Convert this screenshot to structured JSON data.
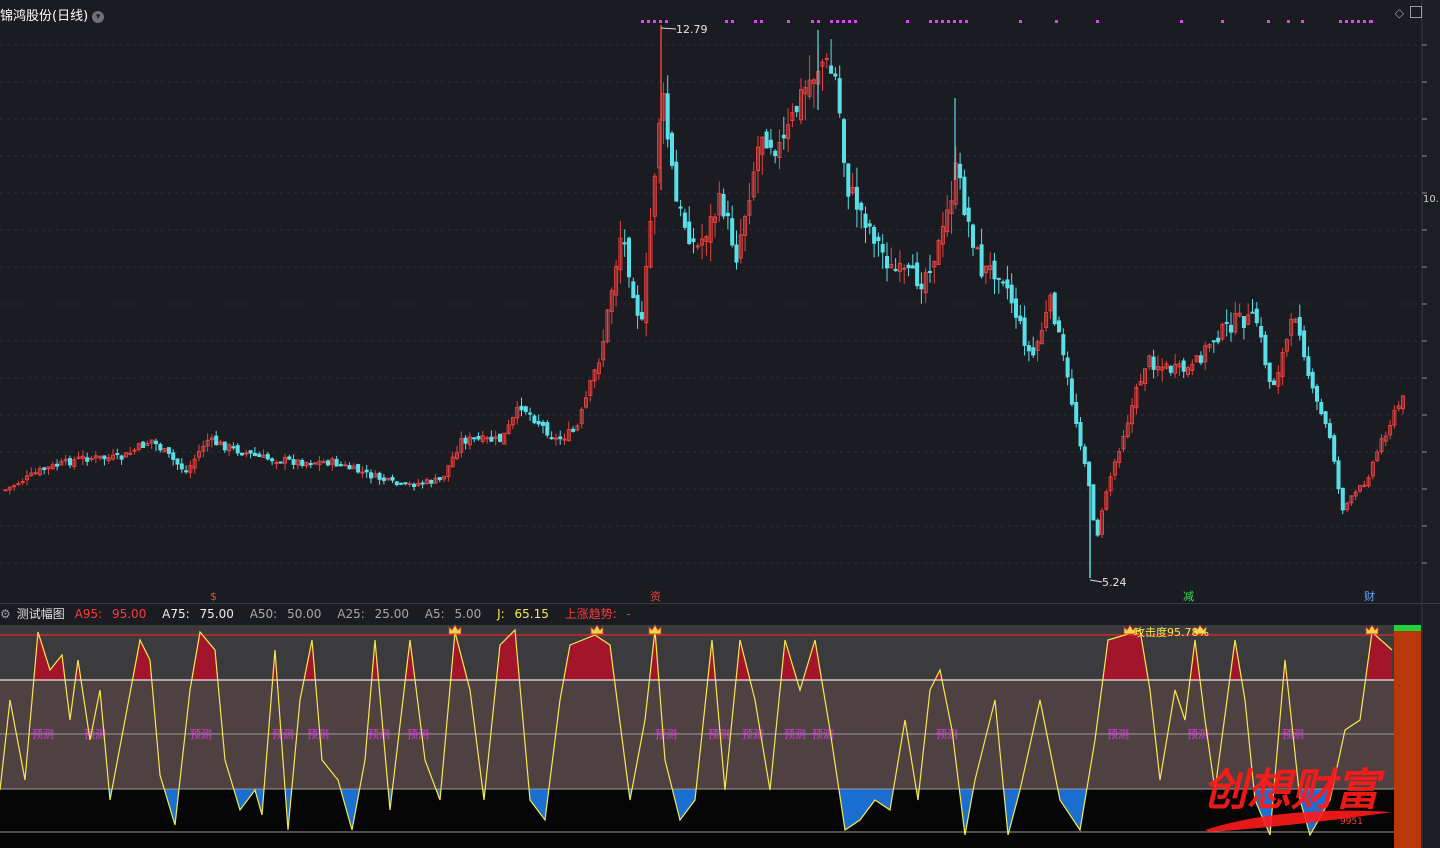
{
  "header": {
    "title": "锦鸿股份(日线)",
    "title_menu_icon": "chevron-down-icon",
    "diamond_icon": "diamond-icon",
    "window_icon": "restore-window-icon"
  },
  "price_annotations": {
    "high_label": "12.79",
    "low_label": "5.24"
  },
  "right_axis": {
    "visible_label": "10."
  },
  "event_markers": [
    "$",
    "减",
    "财"
  ],
  "event_marker_partial": "资",
  "sub_indicator": {
    "name": "测试幅图",
    "a95_label": "A95:",
    "a95_value": "95.00",
    "a75_label": "A75:",
    "a75_value": "75.00",
    "a50_label": "A50:",
    "a50_value": "50.00",
    "a25_label": "A25:",
    "a25_value": "25.00",
    "a5_label": "A5:",
    "a5_value": "5.00",
    "j_label": "J:",
    "j_value": "65.15",
    "trend_label": "上涨趋势:",
    "trend_value": "-",
    "attack_text": "攻击度95.78%",
    "signal_text": "预测",
    "levels": [
      95,
      75,
      50,
      25,
      5
    ]
  },
  "watermark": {
    "text": "创想财富",
    "number": "9951"
  },
  "colors": {
    "background": "#1b1c22",
    "candle_up": "#e8413f",
    "candle_down": "#58dfe8",
    "top_markers": "#e040fb",
    "indicator_line": "#f6e94b",
    "fill_high": "#a3152a",
    "fill_low": "#1a6fd1",
    "band_upper": "#3b3b3d",
    "band_mid": "#4f4142",
    "band_lower": "#060606",
    "signal_text": "#d640d6",
    "watermark": "#ff1a1a"
  }
}
